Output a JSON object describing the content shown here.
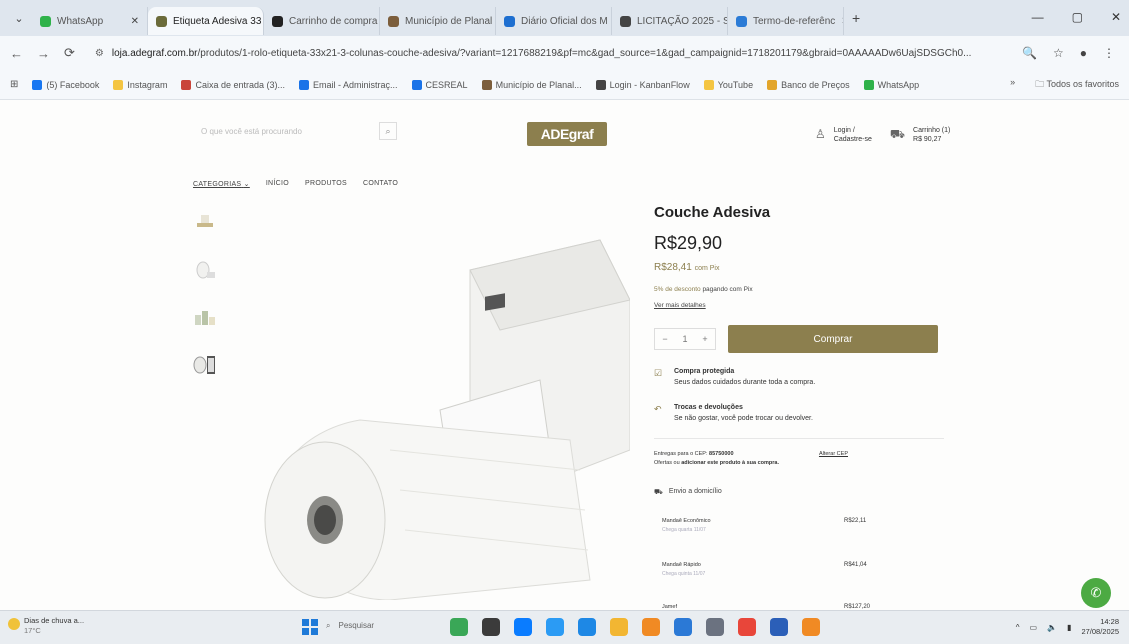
{
  "browser": {
    "tab_menu_icon": "chevron-down-icon",
    "tabs": [
      {
        "title": "WhatsApp",
        "color": "#2fb24a",
        "active": false
      },
      {
        "title": "Etiqueta Adesiva 33",
        "color": "#6b6b3a",
        "active": true
      },
      {
        "title": "Carrinho de compra",
        "color": "#222222",
        "active": false
      },
      {
        "title": "Município de Planal",
        "color": "#7c5e3c",
        "active": false
      },
      {
        "title": "Diário Oficial dos M",
        "color": "#1e6fd0",
        "active": false
      },
      {
        "title": "LICITAÇÃO 2025 - S",
        "color": "#444444",
        "active": false
      },
      {
        "title": "Termo-de-referênc",
        "color": "#2b7bd6",
        "active": false
      }
    ],
    "url_host": "loja.adegraf.com.br",
    "url_path": "/produtos/1-rolo-etiqueta-33x21-3-colunas-couche-adesiva/?variant=1217688219&pf=mc&gad_source=1&gad_campaignid=1718201179&gbraid=0AAAAADw6UajSDSGCh0...",
    "bookmarks": [
      {
        "label": "(5) Facebook",
        "color": "#1877f2"
      },
      {
        "label": "Instagram",
        "color": "#f4c542"
      },
      {
        "label": "Caixa de entrada (3)...",
        "color": "#c9453a"
      },
      {
        "label": "Email - Administraç...",
        "color": "#1a73e8"
      },
      {
        "label": "CESREAL",
        "color": "#1a73e8"
      },
      {
        "label": "Município de Planal...",
        "color": "#7c5e3c"
      },
      {
        "label": "Login - KanbanFlow",
        "color": "#444444"
      },
      {
        "label": "YouTube",
        "color": "#f4c542"
      },
      {
        "label": "Banco de Preços",
        "color": "#e2a52b"
      },
      {
        "label": "WhatsApp",
        "color": "#2fb24a"
      }
    ],
    "bookmarks_more": "»",
    "all_bookmarks": "Todos os favoritos"
  },
  "site": {
    "search_placeholder": "O que você está procurando",
    "logo": "ADEgraf",
    "login_line1": "Login /",
    "login_line2": "Cadastre-se",
    "cart_line1": "Carrinho (1)",
    "cart_line2": "R$ 90,27",
    "menu": [
      "CATEGORIAS",
      "INÍCIO",
      "PRODUTOS",
      "CONTATO"
    ],
    "product": {
      "title": "Couche Adesiva",
      "price": "R$29,90",
      "pix_price": "R$28,41",
      "pix_label": "com Pix",
      "discount_pct": "5% de desconto",
      "discount_rest": "pagando com Pix",
      "more_details": "Ver mais detalhes",
      "qty_minus": "−",
      "qty": "1",
      "qty_plus": "+",
      "buy": "Comprar"
    },
    "features": [
      {
        "title": "Compra protegida",
        "text": "Seus dados cuidados durante toda a compra.",
        "icon": "shield-check-icon"
      },
      {
        "title": "Trocas e devoluções",
        "text": "Se não gostar, você pode trocar ou devolver.",
        "icon": "return-arrow-icon"
      }
    ],
    "shipping": {
      "line1_prefix": "Entregas para o CEP:",
      "cep": "85750000",
      "line2_prefix": "Ofertas ou",
      "line2_bold": "adicionar este produto à sua compra.",
      "change_cep": "Alterar CEP",
      "home_delivery": "Envio a domicílio"
    },
    "options": [
      {
        "name": "Mandaê Econômico",
        "eta": "Chega quarta 11/07",
        "price": "R$22,11"
      },
      {
        "name": "Mandaê Rápido",
        "eta": "Chega quinta 11/07",
        "price": "R$41,04"
      },
      {
        "name": "Jamef",
        "eta": "",
        "price": "R$127,20"
      }
    ]
  },
  "taskbar": {
    "weather_title": "Dias de chuva a...",
    "weather_temp": "17°C",
    "search": "Pesquisar",
    "apps": [
      "#3aa757",
      "#3b3b3b",
      "#0a7cff",
      "#2b9bf4",
      "#1e88e5",
      "#f2b632",
      "#f08a24",
      "#2b79d6",
      "#6b7280",
      "#e8463a",
      "#2b5fb8",
      "#f08a24"
    ],
    "time": "14:28",
    "date": "27/08/2025"
  }
}
